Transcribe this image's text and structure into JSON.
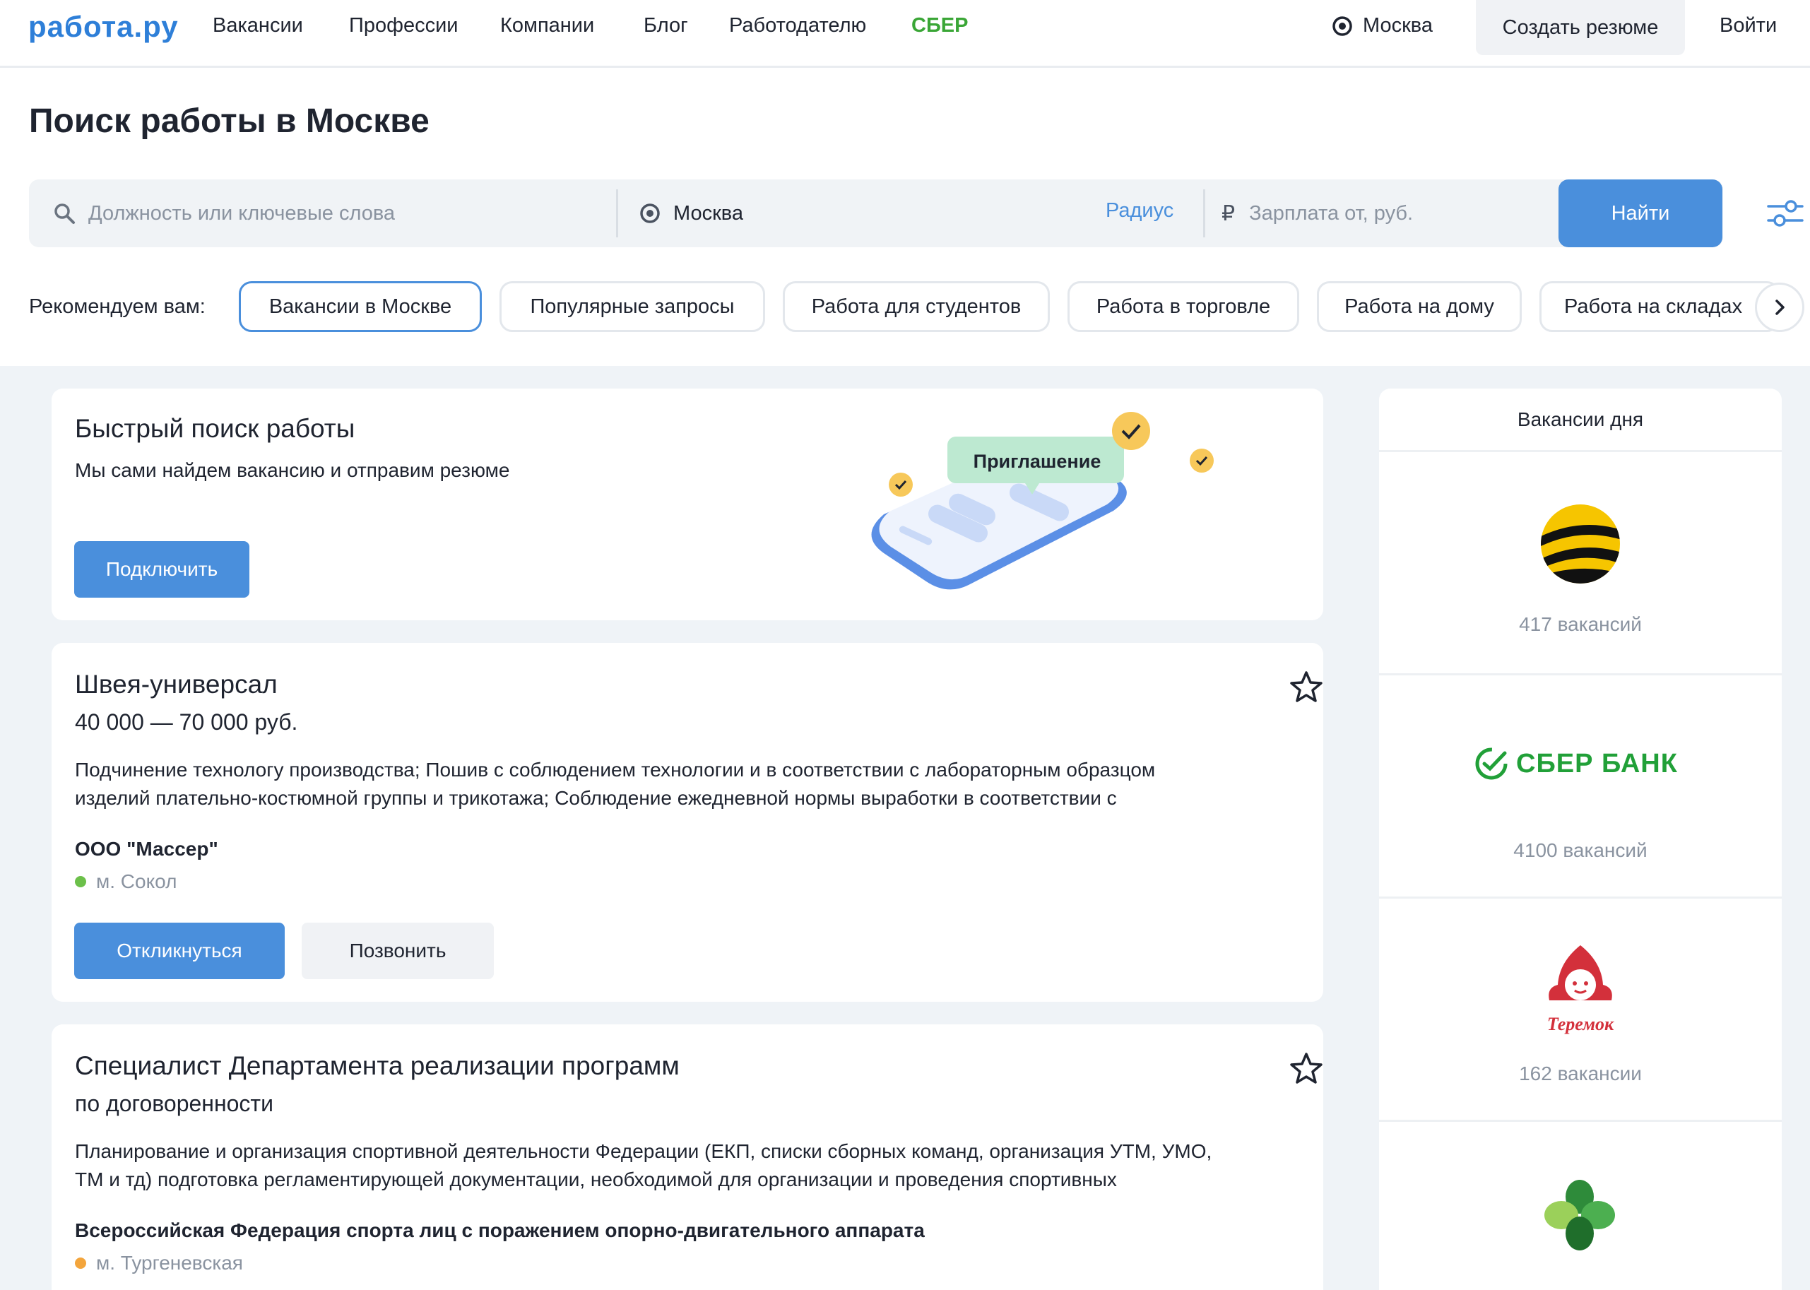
{
  "header": {
    "logo": "работа.ру",
    "nav": [
      "Вакансии",
      "Профессии",
      "Компании",
      "Блог",
      "Работодателю"
    ],
    "nav_sber": "СБЕР",
    "city": "Москва",
    "create_resume": "Создать резюме",
    "login": "Войти"
  },
  "search": {
    "title": "Поиск работы в Москве",
    "keyword_placeholder": "Должность или ключевые слова",
    "city_value": "Москва",
    "radius_label": "Радиус",
    "currency_symbol": "₽",
    "salary_placeholder": "Зарплата от, руб.",
    "find_button": "Найти"
  },
  "recommend": {
    "label": "Рекомендуем вам:",
    "chips": [
      "Вакансии в Москве",
      "Популярные запросы",
      "Работа для студентов",
      "Работа в торговле",
      "Работа на дому",
      "Работа на складах"
    ]
  },
  "promo": {
    "title": "Быстрый поиск работы",
    "subtitle": "Мы сами найдем вакансию и отправим резюме",
    "button": "Подключить",
    "bubble": "Приглашение"
  },
  "vacancies": [
    {
      "title": "Швея-универсал",
      "salary": "40 000 — 70 000 руб.",
      "description_line1": "Подчинение технологу производства; Пошив с соблюдением технологии и в соответствии с лабораторным образцом",
      "description_line2": "изделий плательно-костюмной группы и трикотажа; Соблюдение ежедневной нормы выработки в соответствии с",
      "company": "ООО \"Массер\"",
      "metro": "м. Сокол",
      "metro_color": "#6cc04a",
      "respond": "Откликнуться",
      "call": "Позвонить"
    },
    {
      "title": "Специалист Департамента реализации программ",
      "salary": "по договоренности",
      "description_line1": "Планирование и организация спортивной деятельности Федерации (ЕКП, списки сборных команд, организация УТМ, УМО,",
      "description_line2": "ТМ и тд) подготовка регламентирующей документации, необходимой для организации и проведения спортивных",
      "company": "Всероссийская Федерация спорта лиц с поражением опорно-двигательного аппарата",
      "metro": "м. Тургеневская",
      "metro_color": "#f3a53c"
    }
  ],
  "sidebar": {
    "title": "Вакансии дня",
    "items": [
      {
        "logo": "beeline-logo",
        "count": "417 вакансий"
      },
      {
        "logo": "sberbank-logo",
        "logo_text": "СБЕР БАНК",
        "count": "4100 вакансий"
      },
      {
        "logo": "teremok-logo",
        "logo_text": "Теремок",
        "count": "162 вакансии"
      },
      {
        "logo": "clover-logo"
      }
    ]
  },
  "colors": {
    "accent": "#4a8fdc",
    "brand_logo": "#2e7fd8",
    "sber_green": "#3aa636",
    "page_bg": "#eff3f7"
  }
}
